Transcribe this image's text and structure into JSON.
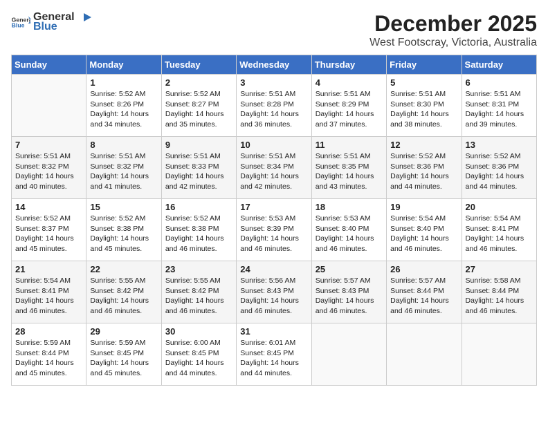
{
  "header": {
    "logo_general": "General",
    "logo_blue": "Blue",
    "month": "December 2025",
    "location": "West Footscray, Victoria, Australia"
  },
  "days_of_week": [
    "Sunday",
    "Monday",
    "Tuesday",
    "Wednesday",
    "Thursday",
    "Friday",
    "Saturday"
  ],
  "weeks": [
    [
      {
        "day": "",
        "info": ""
      },
      {
        "day": "1",
        "info": "Sunrise: 5:52 AM\nSunset: 8:26 PM\nDaylight: 14 hours\nand 34 minutes."
      },
      {
        "day": "2",
        "info": "Sunrise: 5:52 AM\nSunset: 8:27 PM\nDaylight: 14 hours\nand 35 minutes."
      },
      {
        "day": "3",
        "info": "Sunrise: 5:51 AM\nSunset: 8:28 PM\nDaylight: 14 hours\nand 36 minutes."
      },
      {
        "day": "4",
        "info": "Sunrise: 5:51 AM\nSunset: 8:29 PM\nDaylight: 14 hours\nand 37 minutes."
      },
      {
        "day": "5",
        "info": "Sunrise: 5:51 AM\nSunset: 8:30 PM\nDaylight: 14 hours\nand 38 minutes."
      },
      {
        "day": "6",
        "info": "Sunrise: 5:51 AM\nSunset: 8:31 PM\nDaylight: 14 hours\nand 39 minutes."
      }
    ],
    [
      {
        "day": "7",
        "info": "Sunrise: 5:51 AM\nSunset: 8:32 PM\nDaylight: 14 hours\nand 40 minutes."
      },
      {
        "day": "8",
        "info": "Sunrise: 5:51 AM\nSunset: 8:32 PM\nDaylight: 14 hours\nand 41 minutes."
      },
      {
        "day": "9",
        "info": "Sunrise: 5:51 AM\nSunset: 8:33 PM\nDaylight: 14 hours\nand 42 minutes."
      },
      {
        "day": "10",
        "info": "Sunrise: 5:51 AM\nSunset: 8:34 PM\nDaylight: 14 hours\nand 42 minutes."
      },
      {
        "day": "11",
        "info": "Sunrise: 5:51 AM\nSunset: 8:35 PM\nDaylight: 14 hours\nand 43 minutes."
      },
      {
        "day": "12",
        "info": "Sunrise: 5:52 AM\nSunset: 8:36 PM\nDaylight: 14 hours\nand 44 minutes."
      },
      {
        "day": "13",
        "info": "Sunrise: 5:52 AM\nSunset: 8:36 PM\nDaylight: 14 hours\nand 44 minutes."
      }
    ],
    [
      {
        "day": "14",
        "info": "Sunrise: 5:52 AM\nSunset: 8:37 PM\nDaylight: 14 hours\nand 45 minutes."
      },
      {
        "day": "15",
        "info": "Sunrise: 5:52 AM\nSunset: 8:38 PM\nDaylight: 14 hours\nand 45 minutes."
      },
      {
        "day": "16",
        "info": "Sunrise: 5:52 AM\nSunset: 8:38 PM\nDaylight: 14 hours\nand 46 minutes."
      },
      {
        "day": "17",
        "info": "Sunrise: 5:53 AM\nSunset: 8:39 PM\nDaylight: 14 hours\nand 46 minutes."
      },
      {
        "day": "18",
        "info": "Sunrise: 5:53 AM\nSunset: 8:40 PM\nDaylight: 14 hours\nand 46 minutes."
      },
      {
        "day": "19",
        "info": "Sunrise: 5:54 AM\nSunset: 8:40 PM\nDaylight: 14 hours\nand 46 minutes."
      },
      {
        "day": "20",
        "info": "Sunrise: 5:54 AM\nSunset: 8:41 PM\nDaylight: 14 hours\nand 46 minutes."
      }
    ],
    [
      {
        "day": "21",
        "info": "Sunrise: 5:54 AM\nSunset: 8:41 PM\nDaylight: 14 hours\nand 46 minutes."
      },
      {
        "day": "22",
        "info": "Sunrise: 5:55 AM\nSunset: 8:42 PM\nDaylight: 14 hours\nand 46 minutes."
      },
      {
        "day": "23",
        "info": "Sunrise: 5:55 AM\nSunset: 8:42 PM\nDaylight: 14 hours\nand 46 minutes."
      },
      {
        "day": "24",
        "info": "Sunrise: 5:56 AM\nSunset: 8:43 PM\nDaylight: 14 hours\nand 46 minutes."
      },
      {
        "day": "25",
        "info": "Sunrise: 5:57 AM\nSunset: 8:43 PM\nDaylight: 14 hours\nand 46 minutes."
      },
      {
        "day": "26",
        "info": "Sunrise: 5:57 AM\nSunset: 8:44 PM\nDaylight: 14 hours\nand 46 minutes."
      },
      {
        "day": "27",
        "info": "Sunrise: 5:58 AM\nSunset: 8:44 PM\nDaylight: 14 hours\nand 46 minutes."
      }
    ],
    [
      {
        "day": "28",
        "info": "Sunrise: 5:59 AM\nSunset: 8:44 PM\nDaylight: 14 hours\nand 45 minutes."
      },
      {
        "day": "29",
        "info": "Sunrise: 5:59 AM\nSunset: 8:45 PM\nDaylight: 14 hours\nand 45 minutes."
      },
      {
        "day": "30",
        "info": "Sunrise: 6:00 AM\nSunset: 8:45 PM\nDaylight: 14 hours\nand 44 minutes."
      },
      {
        "day": "31",
        "info": "Sunrise: 6:01 AM\nSunset: 8:45 PM\nDaylight: 14 hours\nand 44 minutes."
      },
      {
        "day": "",
        "info": ""
      },
      {
        "day": "",
        "info": ""
      },
      {
        "day": "",
        "info": ""
      }
    ]
  ]
}
